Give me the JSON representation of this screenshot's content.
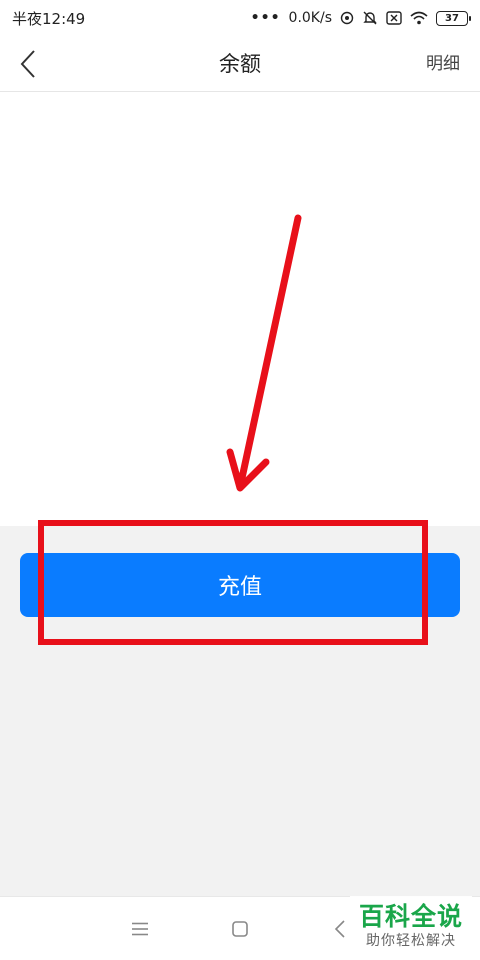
{
  "status_bar": {
    "time": "半夜12:49",
    "more": "•••",
    "network_speed": "0.0K/s",
    "battery_level": "37"
  },
  "header": {
    "title": "余额",
    "detail_label": "明细"
  },
  "main": {
    "recharge_label": "充值"
  },
  "watermark": {
    "title": "百科全说",
    "subtitle": "助你轻松解决"
  },
  "colors": {
    "primary_button": "#0a7cff",
    "annotation": "#e8101a",
    "watermark_green": "#1aa64a"
  }
}
